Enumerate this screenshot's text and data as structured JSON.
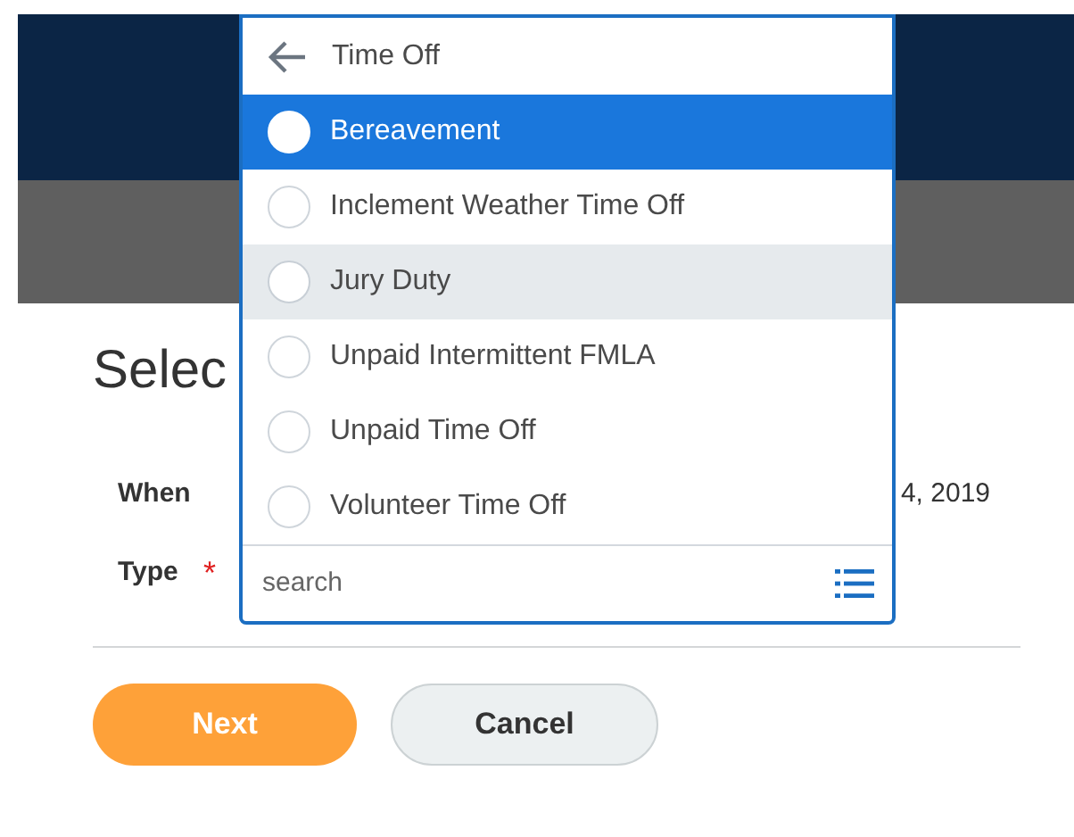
{
  "page": {
    "heading": "Selec",
    "fields": [
      {
        "label": "When",
        "value": "4, 2019"
      },
      {
        "label": "Type",
        "required_mark": "*"
      }
    ]
  },
  "buttons": [
    {
      "label": "Next",
      "kind": "primary"
    },
    {
      "label": "Cancel",
      "kind": "secondary"
    }
  ],
  "dropdown": {
    "title": "Time Off",
    "options": [
      {
        "label": "Bereavement",
        "selected": true,
        "hovered": false
      },
      {
        "label": "Inclement Weather Time Off",
        "selected": false,
        "hovered": false
      },
      {
        "label": "Jury Duty",
        "selected": false,
        "hovered": true
      },
      {
        "label": "Unpaid Intermittent FMLA",
        "selected": false,
        "hovered": false
      },
      {
        "label": "Unpaid Time Off",
        "selected": false,
        "hovered": false
      },
      {
        "label": "Volunteer Time Off",
        "selected": false,
        "hovered": false
      }
    ],
    "search": {
      "placeholder": "search"
    }
  }
}
